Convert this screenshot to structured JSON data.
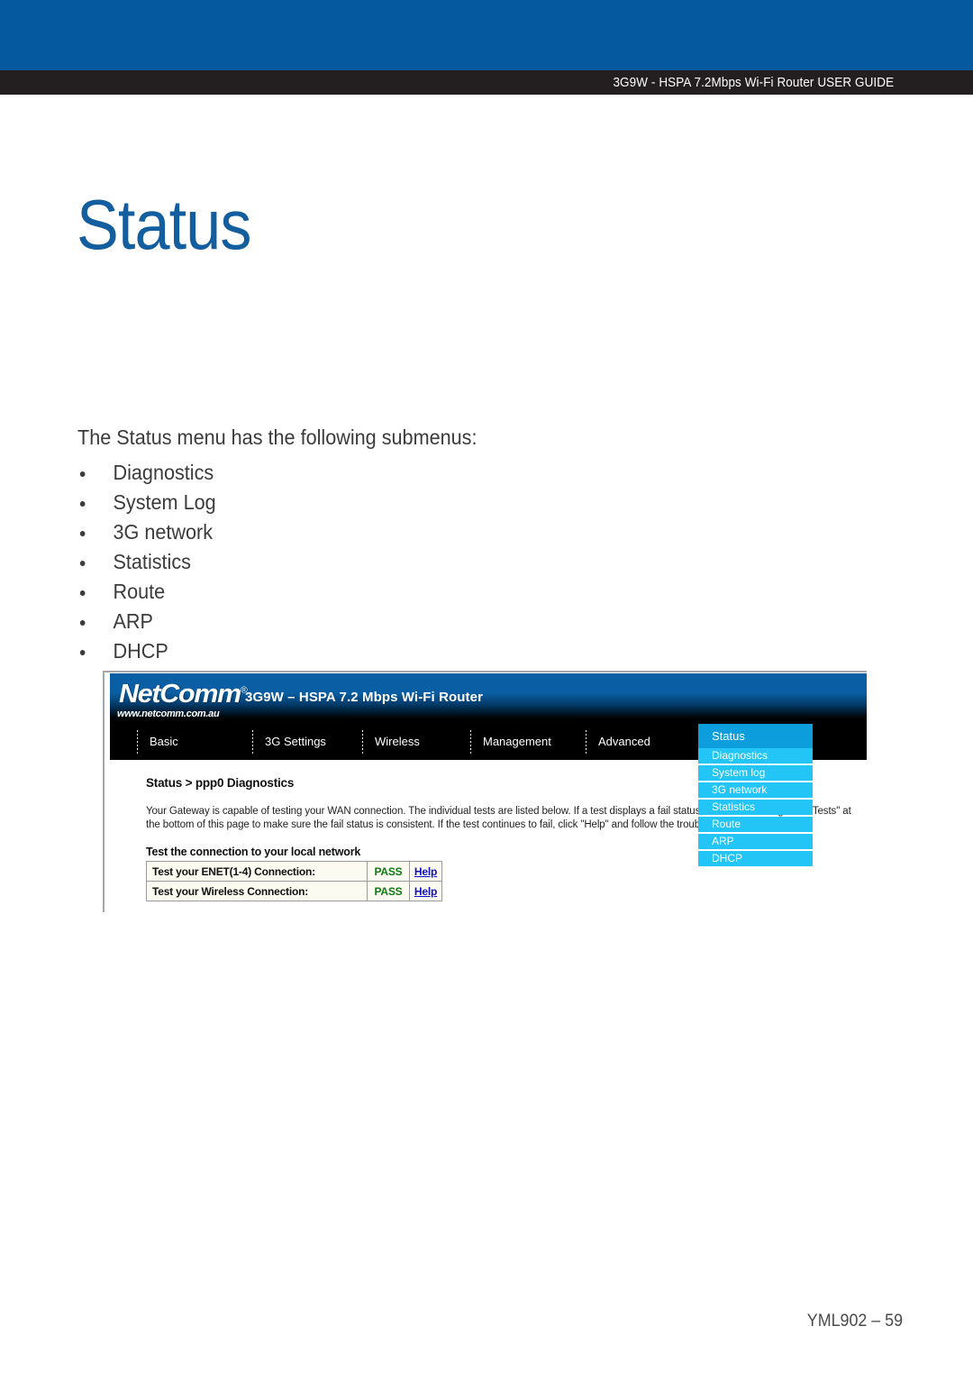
{
  "header": {
    "guide_title": "3G9W - HSPA 7.2Mbps Wi-Fi Router USER GUIDE",
    "band_blue_color": "#04599F",
    "band_dark_color": "#231F20"
  },
  "page": {
    "title": "Status",
    "title_color": "#125E9E",
    "intro": "The Status menu has the following submenus:",
    "bullets": [
      {
        "label": "Diagnostics"
      },
      {
        "label": "System Log"
      },
      {
        "label": "3G network"
      },
      {
        "label": "Statistics"
      },
      {
        "label": "Route"
      },
      {
        "label": "ARP"
      },
      {
        "label": "DHCP"
      }
    ]
  },
  "router_ui": {
    "brand": "NetComm",
    "brand_registered": "®",
    "brand_url": "www.netcomm.com.au",
    "model": "3G9W – HSPA 7.2 Mbps Wi-Fi Router",
    "nav_tabs": [
      {
        "label": "Basic"
      },
      {
        "label": "3G Settings"
      },
      {
        "label": "Wireless"
      },
      {
        "label": "Management"
      },
      {
        "label": "Advanced"
      }
    ],
    "active_tab": "Status",
    "active_tab_color": "#0C9DDC",
    "menu_item_color": "#22C5F6",
    "dropdown_items": [
      {
        "label": "Diagnostics"
      },
      {
        "label": "System log"
      },
      {
        "label": "3G network"
      },
      {
        "label": "Statistics"
      },
      {
        "label": "Route"
      },
      {
        "label": "ARP"
      },
      {
        "label": "DHCP"
      }
    ],
    "breadcrumb": "Status > ppp0 Diagnostics",
    "description": "Your Gateway is capable of testing your WAN connection. The individual tests are listed below. If a test displays a fail status, click \"Rerun Diagnostic Tests\" at the bottom of this page to make sure the fail status is consistent. If the test continues to fail, click \"Help\" and follow the troubleshooting procedures.",
    "section_heading": "Test the connection to your local network",
    "test_rows": [
      {
        "label": "Test your ENET(1-4) Connection:",
        "result": "PASS",
        "help": "Help"
      },
      {
        "label": "Test your Wireless Connection:",
        "result": "PASS",
        "help": "Help"
      }
    ],
    "pass_color": "#0E7A12",
    "link_color": "#1010C8"
  },
  "footer": {
    "text": "YML902 – 59"
  }
}
